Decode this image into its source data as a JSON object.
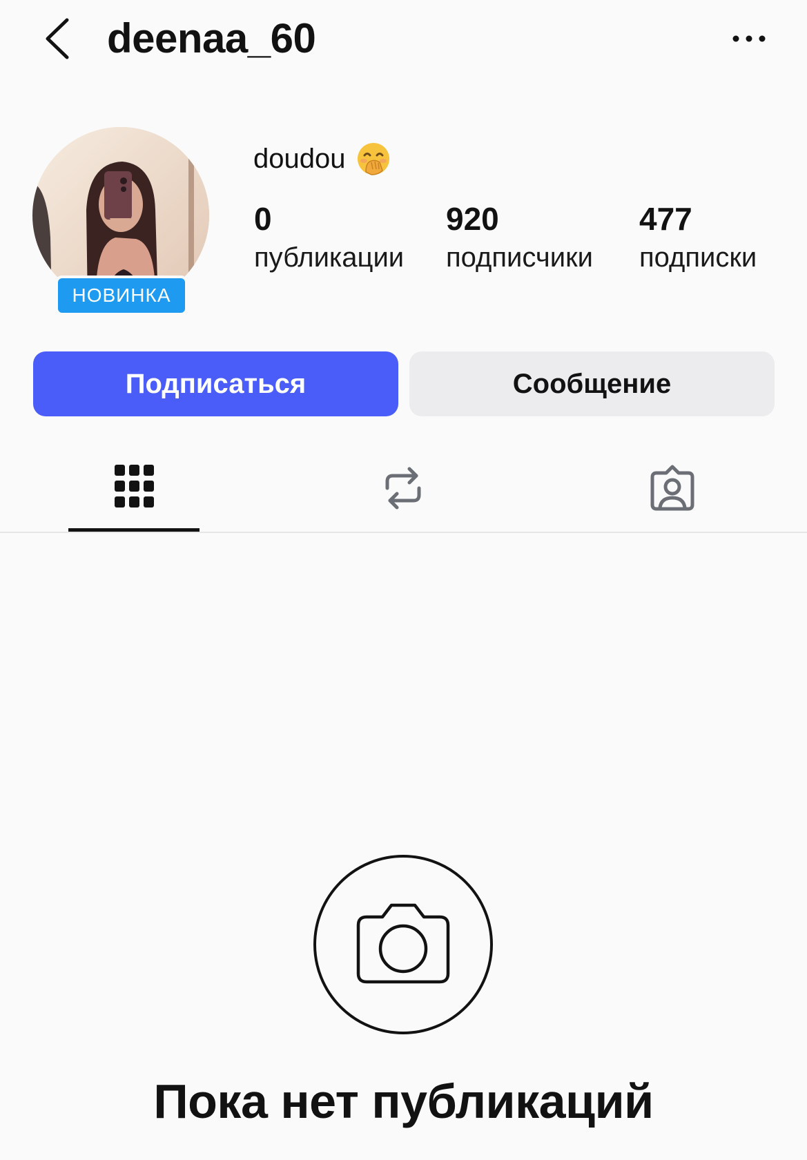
{
  "header": {
    "username": "deenaa_60",
    "back_icon": "chevron-left-icon",
    "more_icon": "ellipsis-icon"
  },
  "profile": {
    "display_name": "doudou",
    "emoji": "🤭",
    "badge_label": "НОВИНКА",
    "stats": {
      "posts": {
        "value": "0",
        "label": "публикации"
      },
      "followers": {
        "value": "920",
        "label": "подписчики"
      },
      "following": {
        "value": "477",
        "label": "подписки"
      }
    }
  },
  "actions": {
    "follow_label": "Подписаться",
    "message_label": "Сообщение"
  },
  "tabs": [
    {
      "name": "posts-grid",
      "icon": "grid-icon",
      "active": true
    },
    {
      "name": "reposts",
      "icon": "repost-icon",
      "active": false
    },
    {
      "name": "tagged",
      "icon": "tagged-person-icon",
      "active": false
    }
  ],
  "empty_state": {
    "title": "Пока нет публикаций",
    "icon": "camera-icon"
  },
  "colors": {
    "background": "#fafafa",
    "follow_button": "#4a5df9",
    "message_button": "#ececef",
    "badge": "#1e9bf0",
    "text": "#121212"
  }
}
